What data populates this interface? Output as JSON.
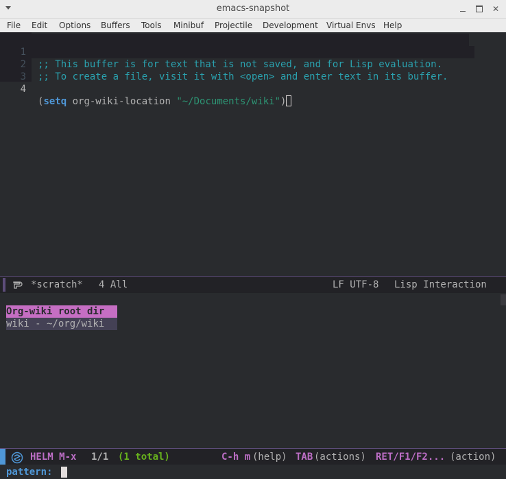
{
  "window": {
    "title": "emacs-snapshot",
    "controls": {
      "minimize": "minimize",
      "maximize": "maximize",
      "close": "✕"
    }
  },
  "menubar": {
    "items": [
      "File",
      "Edit",
      "Options",
      "Buffers",
      "Tools",
      "Minibuf",
      "Projectile",
      "Development",
      "Virtual Envs",
      "Help"
    ]
  },
  "editor": {
    "lines": [
      {
        "num": "1",
        "text": ";; This buffer is for text that is not saved, and for Lisp evaluation."
      },
      {
        "num": "2",
        "text": ";; To create a file, visit it with <open> and enter text in its buffer."
      },
      {
        "num": "3",
        "text": ""
      },
      {
        "num": "4",
        "open": "(",
        "keyword": "setq",
        "middle": " org-wiki-location ",
        "string": "\"~/Documents/wiki\"",
        "close": ")"
      }
    ]
  },
  "modeline": {
    "buffer_name": "*scratch*",
    "position": "4 All",
    "encoding": "LF UTF-8",
    "major_mode": "Lisp Interaction"
  },
  "helm": {
    "source_header": "Org-wiki root dir",
    "candidates": [
      "wiki - ~/org/wiki"
    ]
  },
  "helm_modeline": {
    "name": "HELM M-x",
    "count": "1/1",
    "total": "(1 total)",
    "help_key": "C-h m",
    "help_label": "(help)",
    "tab_key": "TAB",
    "tab_label": "(actions)",
    "ret_key": "RET/F1/F2...",
    "ret_label": "(action)"
  },
  "minibuffer": {
    "prompt": "pattern:",
    "value": ""
  },
  "colors": {
    "background": "#292b2e",
    "comment": "#2aa1ae",
    "keyword": "#4f97d7",
    "string": "#2d9574",
    "helm_header": "#c56ec3",
    "helm_selection": "#444155",
    "modeline_accent": "#5d4d7a",
    "green": "#67b11d"
  }
}
